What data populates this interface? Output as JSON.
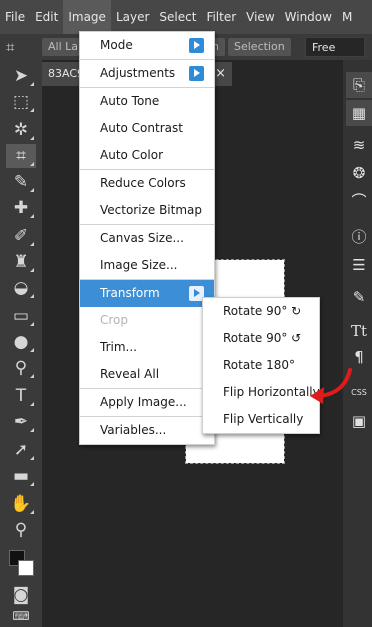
{
  "menubar": {
    "items": [
      "File",
      "Edit",
      "Image",
      "Layer",
      "Select",
      "Filter",
      "View",
      "Window",
      "M"
    ]
  },
  "options_bar": {
    "tool_icon": "crop-icon",
    "all_layers": "All La",
    "right_pill_fragment": "n",
    "selection": "Selection",
    "ratio_value": "Free"
  },
  "document": {
    "tab_name": "83AC9",
    "close_glyph": "×"
  },
  "left_tools": [
    "move-tool-icon",
    "marquee-tool-icon",
    "magic-wand-icon",
    "crop-icon",
    "eyedropper-icon",
    "healing-brush-icon",
    "brush-icon",
    "clone-stamp-icon",
    "eraser-icon",
    "gradient-icon",
    "blur-icon",
    "dodge-icon",
    "type-tool-icon",
    "pen-tool-icon",
    "path-select-icon",
    "shape-tool-icon",
    "hand-tool-icon",
    "zoom-icon"
  ],
  "right_panel": [
    "history-icon",
    "swatches-icon",
    "layers-icon",
    "channels-icon",
    "paths-icon",
    "info-icon",
    "properties-icon",
    "brushes-icon",
    "character-icon",
    "paragraph-icon",
    "css-icon",
    "image-icon"
  ],
  "right_panel_labels": {
    "character": "Tt",
    "paragraph": "¶",
    "css": "CSS"
  },
  "image_menu": {
    "items": [
      {
        "label": "Mode",
        "submenu": true
      },
      {
        "label": "Adjustments",
        "submenu": true
      },
      {
        "label": "Auto Tone"
      },
      {
        "label": "Auto Contrast"
      },
      {
        "label": "Auto Color"
      },
      {
        "label": "Reduce Colors"
      },
      {
        "label": "Vectorize Bitmap"
      },
      {
        "label": "Canvas Size..."
      },
      {
        "label": "Image Size..."
      },
      {
        "label": "Transform",
        "submenu": true,
        "highlighted": true
      },
      {
        "label": "Crop",
        "disabled": true
      },
      {
        "label": "Trim..."
      },
      {
        "label": "Reveal All"
      },
      {
        "label": "Apply Image..."
      },
      {
        "label": "Variables..."
      }
    ]
  },
  "transform_submenu": {
    "items": [
      {
        "label": "Rotate 90° ↻"
      },
      {
        "label": "Rotate 90° ↺"
      },
      {
        "label": "Rotate 180°"
      },
      {
        "label": "Flip Horizontally"
      },
      {
        "label": "Flip Vertically"
      }
    ]
  },
  "colors": {
    "menubar": "#474747",
    "highlight": "#3c8fd6",
    "annotation_arrow": "#e01b1b"
  }
}
